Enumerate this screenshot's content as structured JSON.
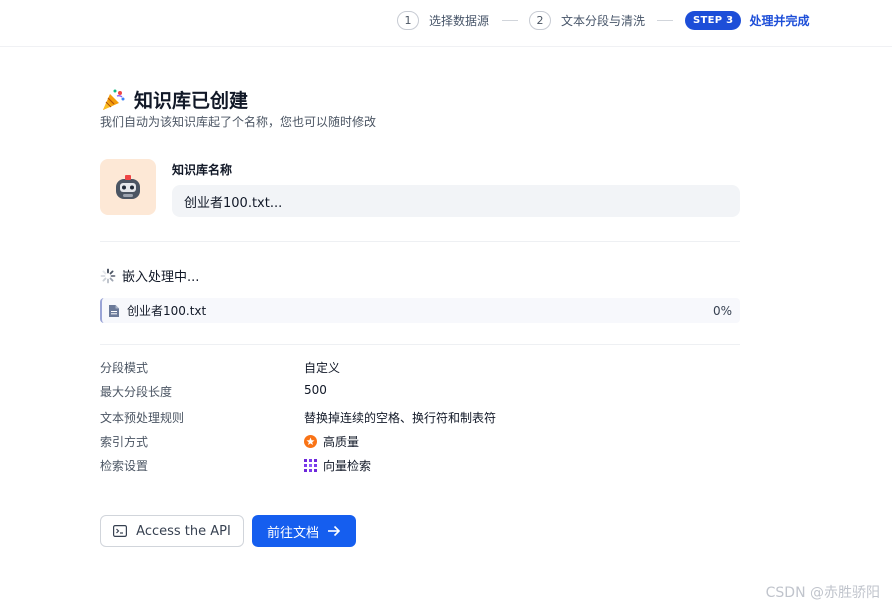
{
  "stepper": {
    "steps": [
      {
        "num": "1",
        "label": "选择数据源"
      },
      {
        "num": "2",
        "label": "文本分段与清洗"
      }
    ],
    "active": {
      "pill": "STEP 3",
      "label": "处理并完成"
    }
  },
  "header": {
    "title": "知识库已创建",
    "subtitle": "我们自动为该知识库起了个名称，您也可以随时修改",
    "icon": "party-popper-icon"
  },
  "kb": {
    "name_label": "知识库名称",
    "name_value": "创业者100.txt...",
    "avatar": "robot-icon"
  },
  "embedding": {
    "status": "嵌入处理中...",
    "file": {
      "name": "创业者100.txt",
      "progress": "0%"
    }
  },
  "details": [
    {
      "key": "分段模式",
      "value": "自定义"
    },
    {
      "key": "最大分段长度",
      "value": "500"
    },
    {
      "key": "文本预处理规则",
      "value": "替换掉连续的空格、换行符和制表符"
    },
    {
      "key": "索引方式",
      "value": "高质量",
      "icon": "high-quality-icon"
    },
    {
      "key": "检索设置",
      "value": "向量检索",
      "icon": "vector-search-icon"
    }
  ],
  "actions": {
    "api_label": "Access the API",
    "doc_label": "前往文档"
  },
  "watermark": "CSDN @赤胜骄阳",
  "colors": {
    "accent": "#155eef",
    "step_active": "#1d4ed8",
    "avatar_bg": "#fde8d6"
  }
}
